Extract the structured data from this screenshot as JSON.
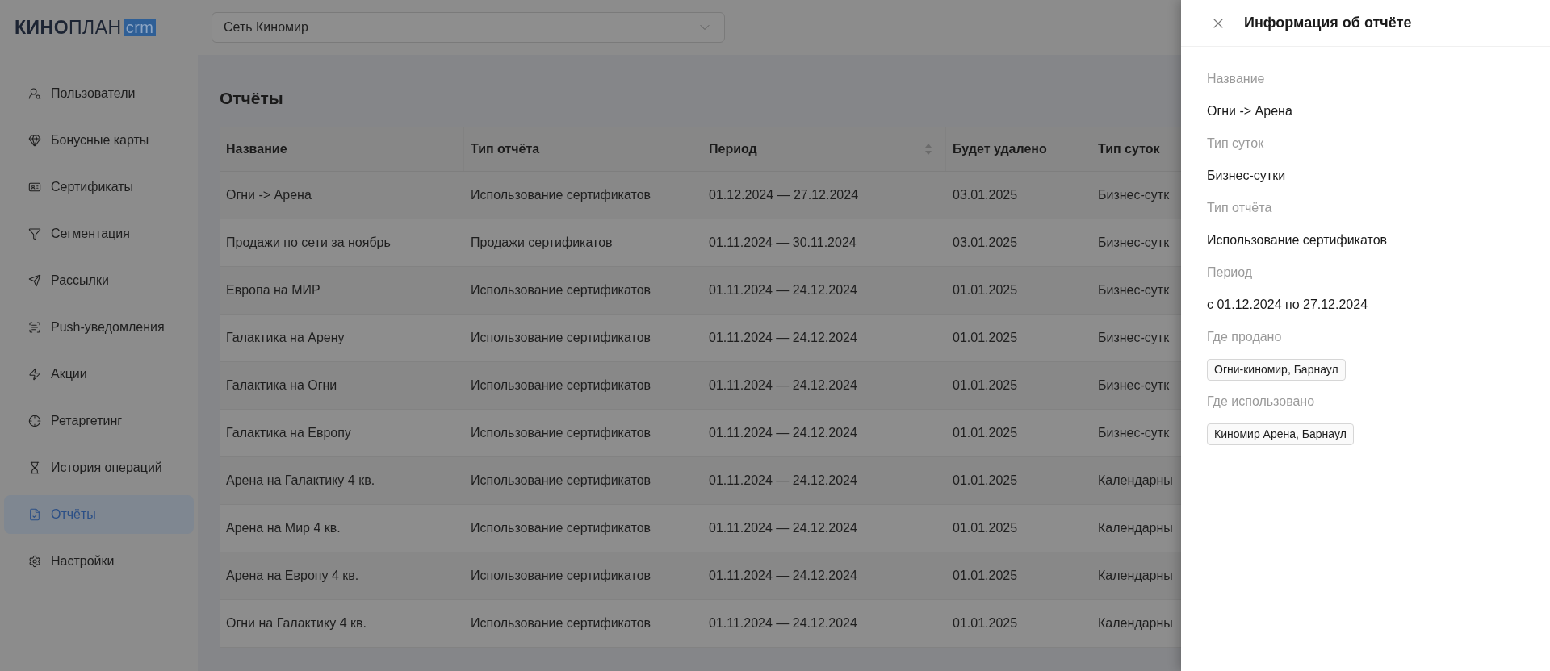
{
  "logo": {
    "bold": "КИНО",
    "light": "ПЛАН",
    "badge": "crm"
  },
  "network_select": {
    "value": "Сеть Киномир"
  },
  "sidebar": {
    "items": [
      {
        "label": "Пользователи",
        "selected": false
      },
      {
        "label": "Бонусные карты",
        "selected": false
      },
      {
        "label": "Сертификаты",
        "selected": false
      },
      {
        "label": "Сегментация",
        "selected": false
      },
      {
        "label": "Рассылки",
        "selected": false
      },
      {
        "label": "Push-уведомления",
        "selected": false
      },
      {
        "label": "Акции",
        "selected": false
      },
      {
        "label": "Ретаргетинг",
        "selected": false
      },
      {
        "label": "История операций",
        "selected": false
      },
      {
        "label": "Отчёты",
        "selected": true
      },
      {
        "label": "Настройки",
        "selected": false
      }
    ]
  },
  "page_title": "Отчёты",
  "table": {
    "columns": [
      {
        "label": "Название",
        "sortable": false
      },
      {
        "label": "Тип отчёта",
        "sortable": false
      },
      {
        "label": "Период",
        "sortable": true
      },
      {
        "label": "Будет удалено",
        "sortable": false
      },
      {
        "label": "Тип суток",
        "sortable": false
      }
    ],
    "rows": [
      [
        "Огни -> Арена",
        "Использование сертификатов",
        "01.12.2024 — 27.12.2024",
        "03.01.2025",
        "Бизнес-сутк"
      ],
      [
        "Продажи по сети за ноябрь",
        "Продажи сертификатов",
        "01.11.2024 — 30.11.2024",
        "03.01.2025",
        "Бизнес-сутк"
      ],
      [
        "Европа на МИР",
        "Использование сертификатов",
        "01.11.2024 — 24.12.2024",
        "01.01.2025",
        "Бизнес-сутк"
      ],
      [
        "Галактика на Арену",
        "Использование сертификатов",
        "01.11.2024 — 24.12.2024",
        "01.01.2025",
        "Бизнес-сутк"
      ],
      [
        "Галактика на Огни",
        "Использование сертификатов",
        "01.11.2024 — 24.12.2024",
        "01.01.2025",
        "Бизнес-сутк"
      ],
      [
        "Галактика на Европу",
        "Использование сертификатов",
        "01.11.2024 — 24.12.2024",
        "01.01.2025",
        "Бизнес-сутк"
      ],
      [
        "Арена на Галактику 4 кв.",
        "Использование сертификатов",
        "01.11.2024 — 24.12.2024",
        "01.01.2025",
        "Календарны"
      ],
      [
        "Арена на Мир 4 кв.",
        "Использование сертификатов",
        "01.11.2024 — 24.12.2024",
        "01.01.2025",
        "Календарны"
      ],
      [
        "Арена на Европу 4 кв.",
        "Использование сертификатов",
        "01.11.2024 — 24.12.2024",
        "01.01.2025",
        "Календарны"
      ],
      [
        "Огни на Галактику 4 кв.",
        "Использование сертификатов",
        "01.11.2024 — 24.12.2024",
        "01.01.2025",
        "Календарны"
      ]
    ]
  },
  "drawer": {
    "title": "Информация об отчёте",
    "fields": [
      {
        "label": "Название",
        "kind": "text",
        "value": "Огни -> Арена"
      },
      {
        "label": "Тип суток",
        "kind": "text",
        "value": "Бизнес-сутки"
      },
      {
        "label": "Тип отчёта",
        "kind": "text",
        "value": "Использование сертификатов"
      },
      {
        "label": "Период",
        "kind": "text",
        "value": "с 01.12.2024 по 27.12.2024"
      },
      {
        "label": "Где продано",
        "kind": "tag",
        "value": "Огни-киномир, Барнаул"
      },
      {
        "label": "Где использовано",
        "kind": "tag",
        "value": "Киномир Арена, Барнаул"
      }
    ]
  }
}
